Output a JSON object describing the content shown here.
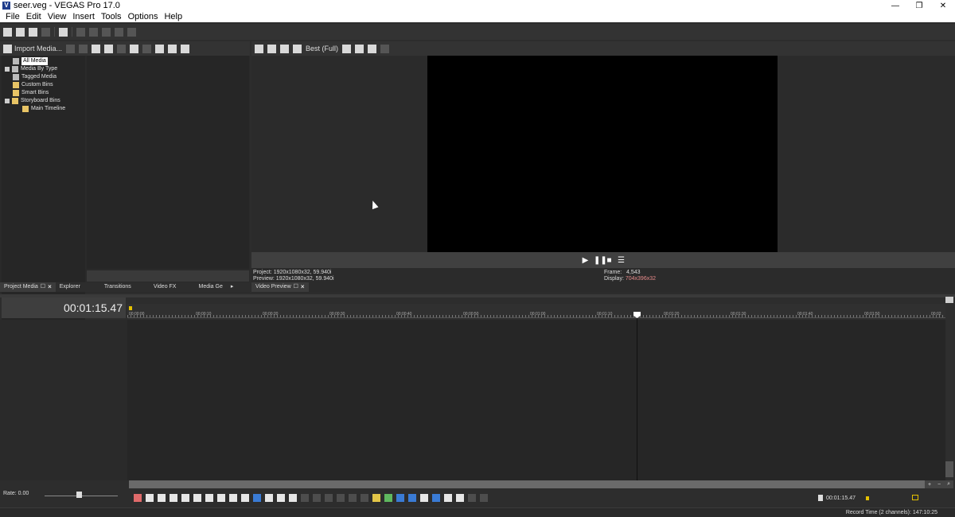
{
  "window": {
    "title": "seer.veg - VEGAS Pro 17.0",
    "logo_letter": "V",
    "controls": [
      "—",
      "❐",
      "✕"
    ]
  },
  "menu": [
    "File",
    "Edit",
    "View",
    "Insert",
    "Tools",
    "Options",
    "Help"
  ],
  "project_media": {
    "import_label": "Import Media...",
    "tree": [
      {
        "label": "All Media",
        "selected": true
      },
      {
        "label": "Media By Type"
      },
      {
        "label": "Tagged Media"
      },
      {
        "label": "Custom Bins"
      },
      {
        "label": "Smart Bins"
      },
      {
        "label": "Storyboard Bins"
      },
      {
        "label": "Main Timeline"
      }
    ]
  },
  "left_tabs": {
    "project_media": "Project Media",
    "explorer": "Explorer",
    "transitions": "Transitions",
    "video_fx": "Video FX",
    "media_gen": "Media Ge"
  },
  "preview": {
    "quality": "Best (Full)",
    "tab_label": "Video Preview",
    "project_label": "Project:",
    "project_value": "1920x1080x32, 59.940i",
    "preview_label": "Preview:",
    "preview_value": "1920x1080x32, 59.940i",
    "frame_label": "Frame:",
    "frame_value": "4,543",
    "display_label": "Display:",
    "display_value": "704x396x32"
  },
  "timeline": {
    "current_time": "00:01:15.47",
    "ruler_labels": [
      "00:00:00",
      "00:00:10",
      "00:00:20",
      "00:00:30",
      "00:00:40",
      "00:00:50",
      "00:01:00",
      "00:01:10",
      "00:01:20",
      "00:01:30",
      "00:01:40",
      "00:01:50",
      "00:02"
    ],
    "end_time": "00:01:15.47"
  },
  "rate_label": "Rate: 0.00",
  "status": "Record Time (2 channels): 147:10:25"
}
